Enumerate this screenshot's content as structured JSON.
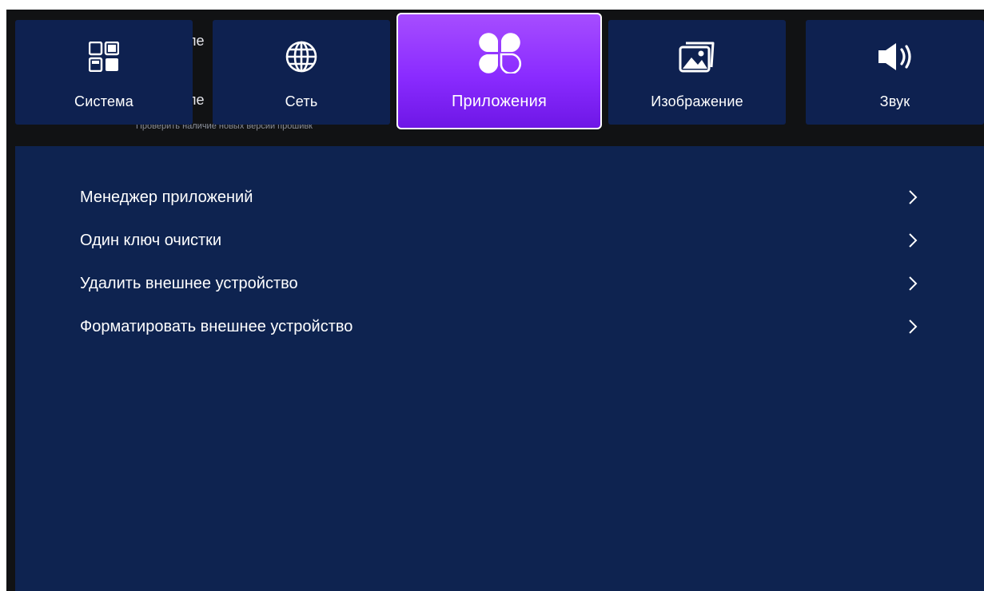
{
  "background": {
    "partial_title_1": "ле",
    "partial_title_2": "ле",
    "partial_subtitle": "Проверить наличие новых версий прошивк"
  },
  "tabs": [
    {
      "label": "Система",
      "icon": "system-grid-icon",
      "active": false
    },
    {
      "label": "Сеть",
      "icon": "globe-icon",
      "active": false
    },
    {
      "label": "Приложения",
      "icon": "apps-clover-icon",
      "active": true
    },
    {
      "label": "Изображение",
      "icon": "picture-icon",
      "active": false
    },
    {
      "label": "Звук",
      "icon": "speaker-icon",
      "active": false
    }
  ],
  "menu": {
    "items": [
      {
        "label": "Менеджер приложений",
        "icon": "chevron-right-icon"
      },
      {
        "label": "Один ключ очистки",
        "icon": "chevron-right-icon"
      },
      {
        "label": "Удалить внешнее устройство",
        "icon": "chevron-right-icon"
      },
      {
        "label": "Форматировать внешнее устройство",
        "icon": "chevron-right-icon"
      }
    ]
  },
  "colors": {
    "screen_bg": "#111214",
    "tile_bg": "#0e2150",
    "panel_bg": "#0e2350",
    "active_accent": "#8a2bff",
    "text": "#ffffff"
  }
}
